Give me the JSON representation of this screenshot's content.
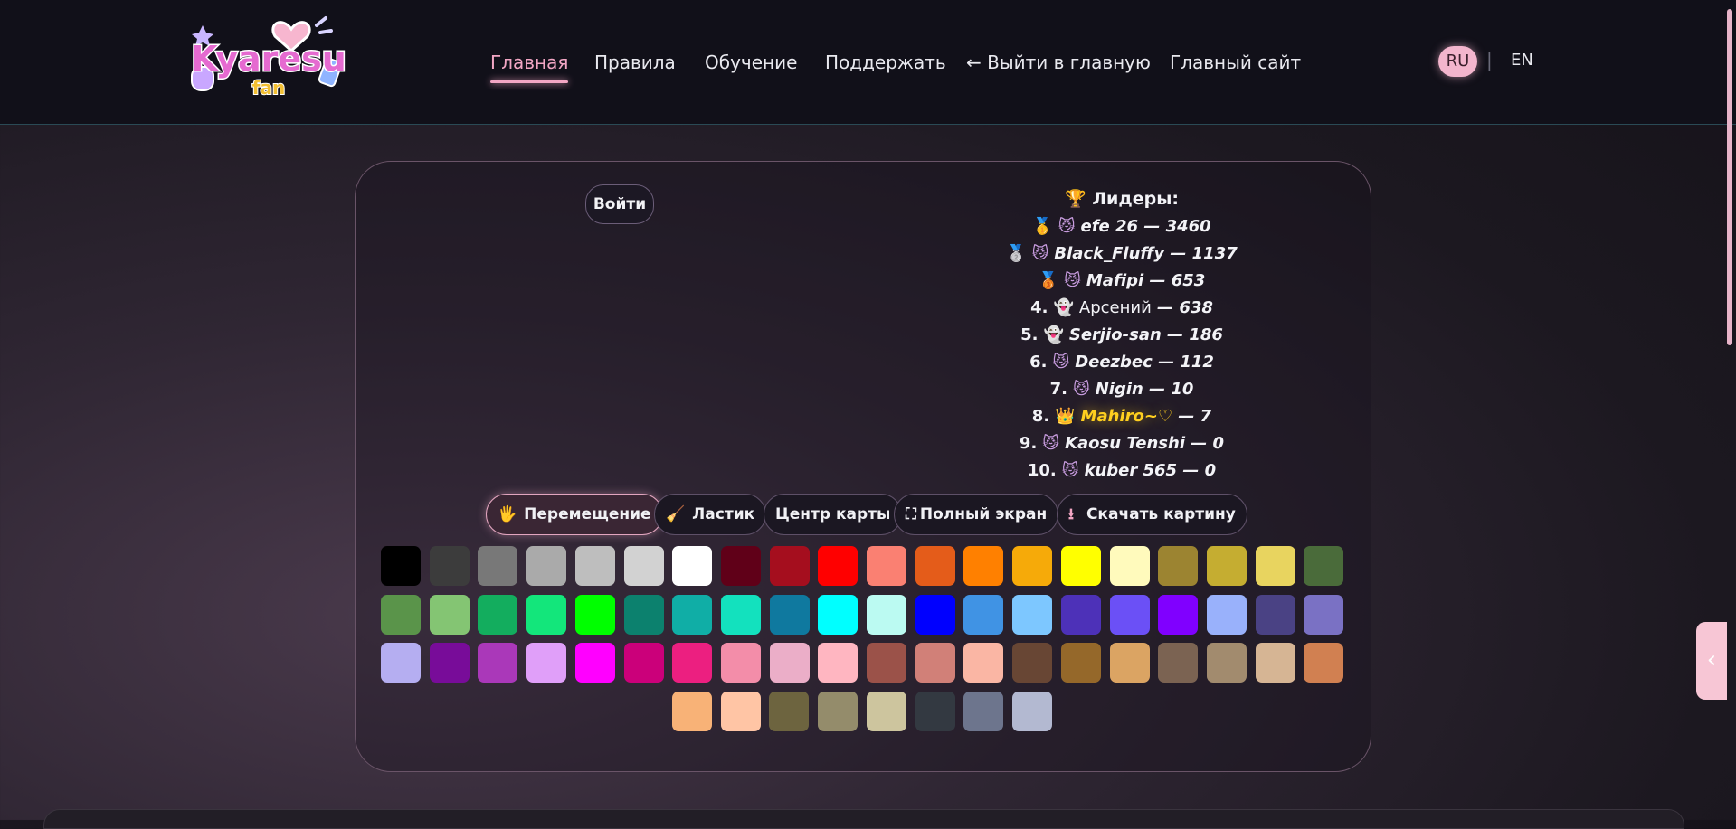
{
  "header": {
    "logo_text": "Kyaresu fan",
    "nav": [
      {
        "label": "Главная",
        "active": true
      },
      {
        "label": "Правила"
      },
      {
        "label": "Обучение"
      },
      {
        "label": "Поддержать"
      },
      {
        "label": "← Выйти в главную"
      },
      {
        "label": "Главный сайт"
      }
    ],
    "lang": {
      "ru": "RU",
      "sep": "|",
      "en": "EN",
      "active": "RU"
    }
  },
  "login_label": "Войти",
  "leaders": {
    "title": "🏆 Лидеры:",
    "rows": [
      {
        "rank": "🥇",
        "icon": "cat-icon",
        "name": "efe 26",
        "score": "3460"
      },
      {
        "rank": "🥈",
        "icon": "cat-icon",
        "name": "Black_Fluffy",
        "score": "1137"
      },
      {
        "rank": "🥉",
        "icon": "cat-icon",
        "name": "Mafipi",
        "score": "653"
      },
      {
        "rank": "4.",
        "icon": "ghost-icon",
        "name": "Арсений",
        "score": "638"
      },
      {
        "rank": "5.",
        "icon": "ghost-icon",
        "name": "Serjio-san",
        "score": "186"
      },
      {
        "rank": "6.",
        "icon": "cat-icon",
        "name": "Deezbec",
        "score": "112"
      },
      {
        "rank": "7.",
        "icon": "cat-icon",
        "name": "Nigin",
        "score": "10"
      },
      {
        "rank": "8.",
        "icon": "crown-icon",
        "name": "Mahiro~♡",
        "score": "7",
        "highlight": true
      },
      {
        "rank": "9.",
        "icon": "cat-icon",
        "name": "Kaosu Tenshi",
        "score": "0"
      },
      {
        "rank": "10.",
        "icon": "cat-icon",
        "name": "kuber 565",
        "score": "0"
      }
    ]
  },
  "toolbar": {
    "move": {
      "icon": "🖐",
      "label": "Перемещение",
      "active": true
    },
    "eraser": {
      "icon": "🧹",
      "label": "Ластик"
    },
    "center": {
      "label": "Центр карты"
    },
    "fullscreen": {
      "icon": "⛶",
      "label": "Полный экран"
    },
    "download": {
      "icon": "⭳",
      "label": "Скачать картину"
    }
  },
  "palette": [
    "#000000",
    "#3c3c3c",
    "#787878",
    "#aaaaaa",
    "#bebebe",
    "#d2d2d2",
    "#ffffff",
    "#600018",
    "#a50e1e",
    "#ff0000",
    "#fa8072",
    "#e45c1a",
    "#ff8000",
    "#f6aa09",
    "#ffff00",
    "#fffabc",
    "#9c8431",
    "#c5ad31",
    "#e8d45f",
    "#4a6b3a",
    "#5a944a",
    "#84c573",
    "#13ad5e",
    "#13e67b",
    "#00ff00",
    "#0c816e",
    "#10aea6",
    "#13e1be",
    "#0f799f",
    "#00ffff",
    "#bbfaf2",
    "#0000ff",
    "#4093e4",
    "#7dc7ff",
    "#4d31b8",
    "#6b50f6",
    "#8000ff",
    "#99b1fb",
    "#4a4284",
    "#7a71c4",
    "#b5aef1",
    "#780c99",
    "#aa38b9",
    "#e09ff9",
    "#ff00ff",
    "#cb007a",
    "#ec1f80",
    "#f38da9",
    "#ebaec8",
    "#ffb6c1",
    "#9b5249",
    "#d18078",
    "#fab6a4",
    "#684634",
    "#95682a",
    "#dba463",
    "#7b6352",
    "#a28b6e",
    "#d6b594",
    "#d18051",
    "#f8b277",
    "#ffc5a5",
    "#6d643f",
    "#948c6b",
    "#cdc59e",
    "#333941",
    "#6d758d",
    "#b3b9d1"
  ],
  "side_tab_label": "‹"
}
